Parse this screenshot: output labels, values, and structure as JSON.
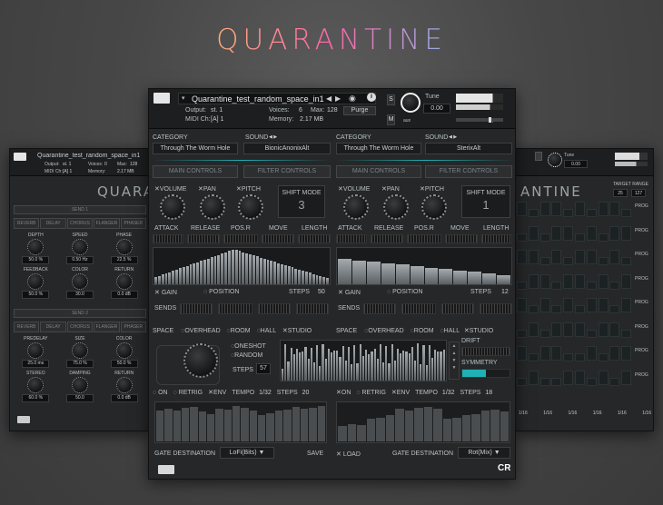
{
  "title": "QUARANTINE",
  "main": {
    "instrument_name": "Quarantine_test_random_space_in1",
    "output_label": "Output:",
    "output_value": "st. 1",
    "midi_label": "MIDI Ch:",
    "midi_value": "[A] 1",
    "voices_label": "Voices:",
    "voices_value": "6",
    "max_label": "Max:",
    "max_value": "128",
    "memory_label": "Memory:",
    "memory_value": "2.17 MB",
    "purge_label": "Purge",
    "tune_label": "Tune",
    "tune_value": "0.00",
    "s_label": "S",
    "m_label": "M",
    "aux_label": "aux",
    "pv_label": "pv",
    "left": {
      "category_label": "CATEGORY",
      "sound_label": "SOUND",
      "category_value": "Through The Worm Hole",
      "sound_value": "BionicAnonixAlt",
      "tab_main": "MAIN CONTROLS",
      "tab_filter": "FILTER CONTROLS",
      "volume": "VOLUME",
      "pan": "PAN",
      "pitch": "PITCH",
      "shift_mode": "SHIFT MODE",
      "shift_value": "3",
      "attack": "ATTACK",
      "release": "RELEASE",
      "pos_r": "POS.R",
      "move": "MOVE",
      "length": "LENGTH",
      "gain": "GAIN",
      "position": "POSITION",
      "steps_label": "STEPS",
      "steps_value": "50",
      "sends": "SENDS",
      "space": "SPACE",
      "overhead": "OVERHEAD",
      "room": "ROOM",
      "hall": "HALL",
      "studio": "STUDIO",
      "oneshot": "ONESHOT",
      "random": "RANDOM",
      "space_steps_value": "57",
      "on": "ON",
      "retrig": "RETRIG",
      "env": "ENV",
      "tempo": "TEMPO",
      "tempo_value": "1/32",
      "gate_steps_value": "20",
      "gate_destination": "GATE DESTINATION",
      "gate_dest_value": "LoFi(Bits)",
      "save": "SAVE"
    },
    "right": {
      "category_label": "CATEGORY",
      "sound_label": "SOUND",
      "category_value": "Through The Worm Hole",
      "sound_value": "SterixAlt",
      "tab_main": "MAIN CONTROLS",
      "tab_filter": "FILTER CONTROLS",
      "volume": "VOLUME",
      "pan": "PAN",
      "pitch": "PITCH",
      "shift_mode": "SHIFT MODE",
      "shift_value": "1",
      "attack": "ATTACK",
      "release": "RELEASE",
      "pos_r": "POS.R",
      "move": "MOVE",
      "length": "LENGTH",
      "gain": "GAIN",
      "position": "POSITION",
      "steps_label": "STEPS",
      "steps_value": "12",
      "sends": "SENDS",
      "space": "SPACE",
      "overhead": "OVERHEAD",
      "room": "ROOM",
      "hall": "HALL",
      "studio": "STUDIO",
      "drift": "DRIFT",
      "symmetry": "SYMMETRY",
      "on": "ON",
      "retrig": "RETRIG",
      "env": "ENV",
      "tempo": "TEMPO",
      "tempo_value": "1/32",
      "gate_steps_value": "18",
      "load": "LOAD",
      "gate_destination": "GATE DESTINATION",
      "gate_dest_value": "Rot(Mix)"
    },
    "brand": "CR"
  },
  "left_win": {
    "instrument_name": "Quarantine_test_random_space_in1",
    "output_label": "Output:",
    "output_value": "st. 1",
    "midi_label": "MIDI Ch:",
    "midi_value": "[A] 1",
    "voices_label": "Voices:",
    "voices_value": "0",
    "max_label": "Max:",
    "max_value": "128",
    "memory_label": "Memory:",
    "memory_value": "2.17 MB",
    "title_partial": "QUARAN",
    "send1": "SEND 1",
    "send2": "SEND 2",
    "fx_tabs": [
      "REVERB",
      "DELAY",
      "CHORUS",
      "FLANGER",
      "PHASER"
    ],
    "k1": [
      {
        "label": "DEPTH",
        "value": "50.0 %"
      },
      {
        "label": "SPEED",
        "value": "0.50 Hz"
      },
      {
        "label": "PHASE",
        "value": "22.5 %"
      }
    ],
    "k2": [
      {
        "label": "FEEDBACK",
        "value": "50.0 %"
      },
      {
        "label": "COLOR",
        "value": "30.0"
      },
      {
        "label": "RETURN",
        "value": "0.0 dB"
      }
    ],
    "k3": [
      {
        "label": "PREDELAY",
        "value": "25.0 ms"
      },
      {
        "label": "SIZE",
        "value": "75.0 %"
      },
      {
        "label": "COLOR",
        "value": "50.0 %"
      }
    ],
    "k4": [
      {
        "label": "STEREO",
        "value": "60.0 %"
      },
      {
        "label": "DAMPING",
        "value": "50.0"
      },
      {
        "label": "RETURN",
        "value": "0.0 dB"
      }
    ]
  },
  "right_win": {
    "title_partial": "ANTINE",
    "tune_label": "Tune",
    "tune_value": "0.00",
    "target_range": "TARGET RANGE",
    "range_lo": "25",
    "range_hi": "127",
    "row_tag": "PROG",
    "bottom_values": [
      "1/16",
      "1/16",
      "1/16",
      "1/16",
      "1/16",
      "1/16"
    ],
    "brand": "CR",
    "grid": [
      [
        1,
        0,
        1,
        1,
        0,
        1,
        0,
        1,
        1,
        0
      ],
      [
        0,
        1,
        0,
        1,
        1,
        0,
        1,
        0,
        1,
        1
      ],
      [
        1,
        1,
        0,
        1,
        0,
        1,
        1,
        0,
        1,
        0
      ],
      [
        0,
        1,
        1,
        0,
        1,
        1,
        0,
        1,
        0,
        1
      ],
      [
        1,
        0,
        1,
        0,
        1,
        0,
        1,
        1,
        0,
        1
      ],
      [
        0,
        1,
        0,
        1,
        1,
        1,
        0,
        1,
        1,
        0
      ],
      [
        1,
        0,
        1,
        1,
        0,
        0,
        1,
        0,
        1,
        1
      ],
      [
        0,
        1,
        0,
        0,
        1,
        1,
        0,
        1,
        0,
        1
      ]
    ]
  }
}
